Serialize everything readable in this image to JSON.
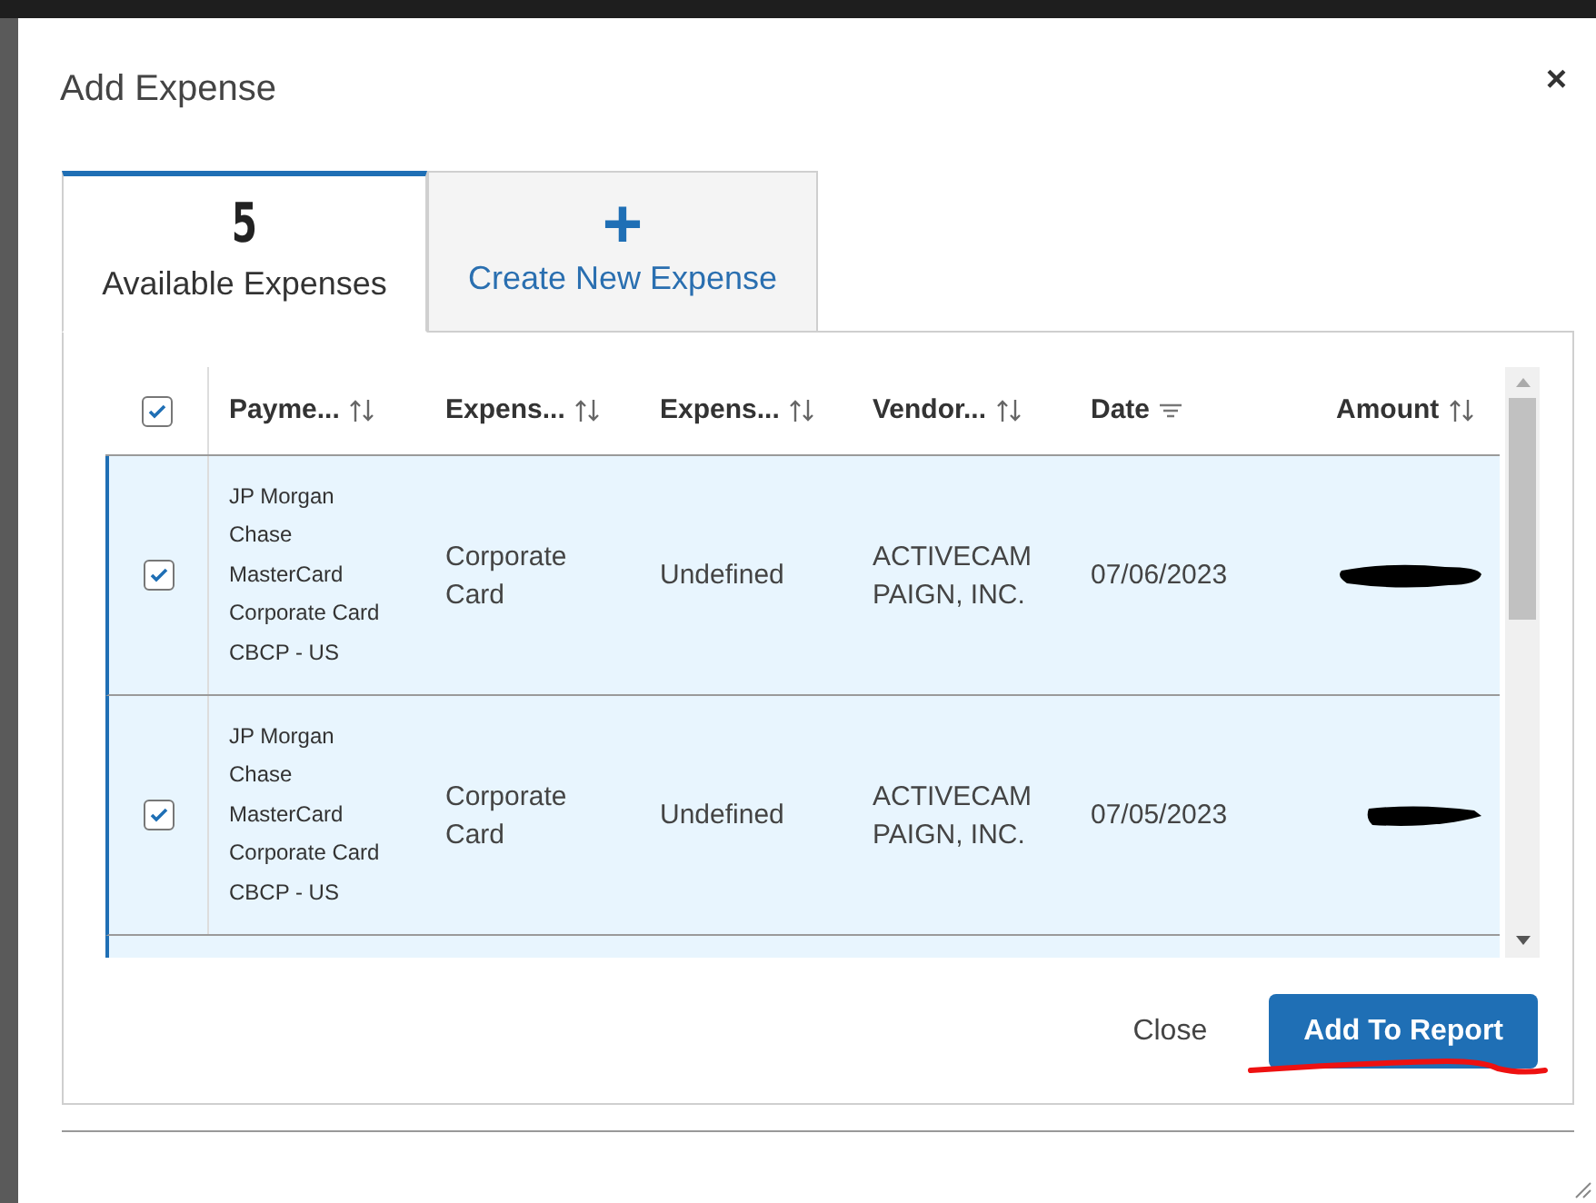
{
  "dialog": {
    "title": "Add Expense",
    "close_label": "×"
  },
  "tabs": [
    {
      "kind": "count",
      "count": "5",
      "label": "Available Expenses",
      "selected": true
    },
    {
      "kind": "create",
      "icon": "+",
      "label": "Create New Expense",
      "selected": false
    }
  ],
  "table": {
    "select_all_checked": true,
    "columns": [
      {
        "label": "Payme...",
        "sorted": false
      },
      {
        "label": "Expens...",
        "sorted": false
      },
      {
        "label": "Expens...",
        "sorted": false
      },
      {
        "label": "Vendor...",
        "sorted": false
      },
      {
        "label": "Date",
        "sorted": true
      },
      {
        "label": "Amount",
        "sorted": false
      }
    ],
    "rows": [
      {
        "selected": true,
        "checked": true,
        "payment": [
          "JP Morgan",
          "Chase",
          "MasterCard",
          "Corporate Card",
          "CBCP - US"
        ],
        "expense_type": "Corporate Card",
        "expense": "Undefined",
        "vendor": "ACTIVECAM PAIGN, INC.",
        "date": "07/06/2023"
      },
      {
        "selected": true,
        "checked": true,
        "payment": [
          "JP Morgan",
          "Chase",
          "MasterCard",
          "Corporate Card",
          "CBCP - US"
        ],
        "expense_type": "Corporate Card",
        "expense": "Undefined",
        "vendor": "ACTIVECAM PAIGN, INC.",
        "date": "07/05/2023"
      }
    ]
  },
  "buttons": {
    "close": "Close",
    "add": "Add To Report"
  }
}
